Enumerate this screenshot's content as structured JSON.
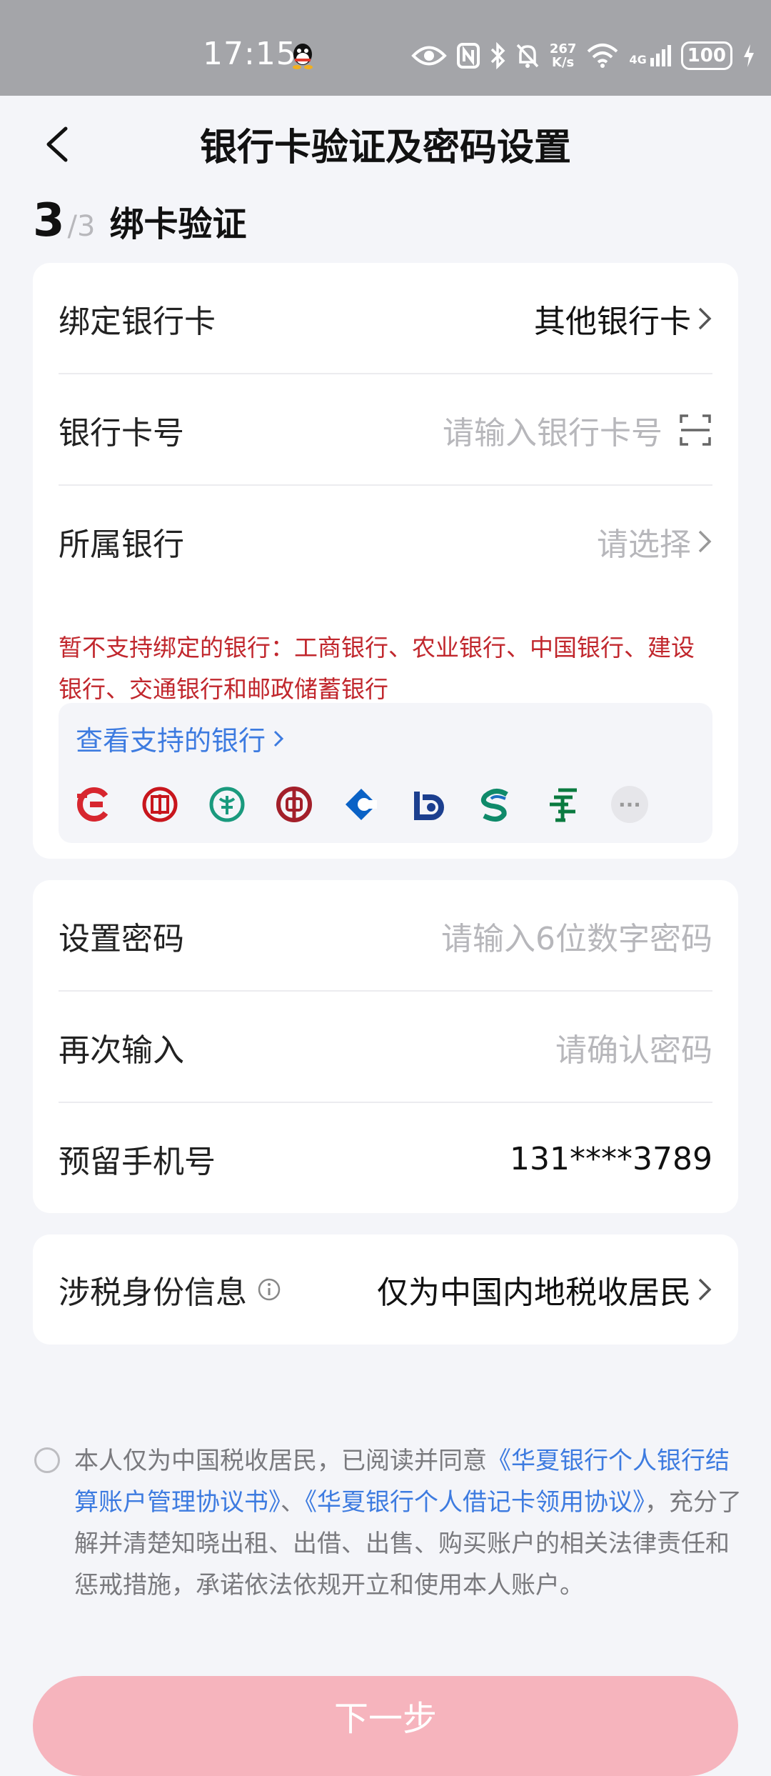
{
  "status_bar": {
    "time": "17:15",
    "net_speed_top": "267",
    "net_speed_bottom": "K/s",
    "signal_label": "4G",
    "battery": "100"
  },
  "nav": {
    "title": "银行卡验证及密码设置"
  },
  "step": {
    "current": "3",
    "total": "/3",
    "label": "绑卡验证"
  },
  "bank_card": {
    "bind_label": "绑定银行卡",
    "bind_value": "其他银行卡",
    "card_no_label": "银行卡号",
    "card_no_placeholder": "请输入银行卡号",
    "bank_label": "所属银行",
    "bank_placeholder": "请选择",
    "warning": "暂不支持绑定的银行：工商银行、农业银行、中国银行、建设银行、交通银行和邮政储蓄银行",
    "supported_link": "查看支持的银行",
    "bank_logos": [
      "huaxia-bank-logo",
      "icbc-logo",
      "abc-logo",
      "boc-logo",
      "ccb-logo",
      "bocom-logo",
      "spdb-logo",
      "psbc-logo"
    ],
    "more_label": "···"
  },
  "password": {
    "set_label": "设置密码",
    "set_placeholder": "请输入6位数字密码",
    "confirm_label": "再次输入",
    "confirm_placeholder": "请确认密码",
    "phone_label": "预留手机号",
    "phone_value": "131****3789"
  },
  "tax": {
    "label": "涉税身份信息",
    "value": "仅为中国内地税收居民"
  },
  "agreement": {
    "text_1": "本人仅为中国税收居民，已阅读并同意",
    "link_1": "《华夏银行个人银行结算账户管理协议书》",
    "sep": "、",
    "link_2": "《华夏银行个人借记卡领用协议》",
    "text_2": "，充分了解并清楚知晓出租、出借、出售、购买账户的相关法律责任和惩戒措施，承诺依法依规开立和使用本人账户。"
  },
  "next_button": "下一步",
  "colors": {
    "accent_red": "#c1272d",
    "link_blue": "#3d7be0",
    "button_pink": "#f6b4bd"
  }
}
